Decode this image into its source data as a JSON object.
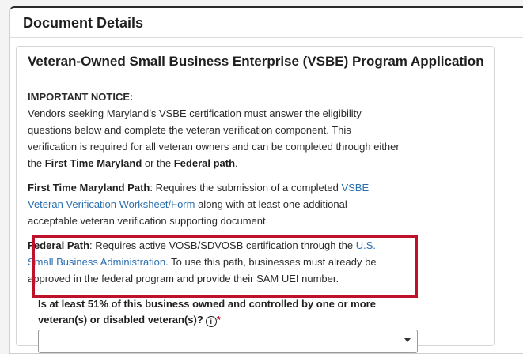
{
  "outer": {
    "title": "Document Details"
  },
  "inner": {
    "title": "Veteran-Owned Small Business Enterprise (VSBE) Program Application"
  },
  "notice": {
    "title": "IMPORTANT NOTICE:",
    "text_before": "Vendors seeking Maryland’s VSBE certification must answer the eligibility questions below and complete the veteran verification component. This verification is required for all veteran owners and can be completed through either the ",
    "bold1": "First Time Maryland",
    "text_mid": " or the ",
    "bold2": "Federal path",
    "text_end": "."
  },
  "maryland": {
    "label": "First Time Maryland Path",
    "text_before": ": Requires the submission of a completed ",
    "link": "VSBE Veteran Verification Worksheet/Form",
    "text_after": " along with at least one additional acceptable veteran verification supporting document."
  },
  "federal": {
    "label": "Federal Path",
    "text_before": ": Requires active VOSB/SDVOSB certification through the ",
    "link": "U.S. Small Business Administration",
    "text_after": ". To use this path, businesses must already be approved in the federal program and provide their SAM UEI number."
  },
  "question": {
    "text": "Is at least 51% of this business owned and controlled by one or more veteran(s) or disabled veteran(s)?",
    "info_glyph": "i",
    "required_mark": "*"
  },
  "select": {
    "value": ""
  },
  "colors": {
    "highlight": "#c0112b",
    "link": "#2a6fb0"
  },
  "icons": [
    "info-icon",
    "chevron-down-icon"
  ]
}
